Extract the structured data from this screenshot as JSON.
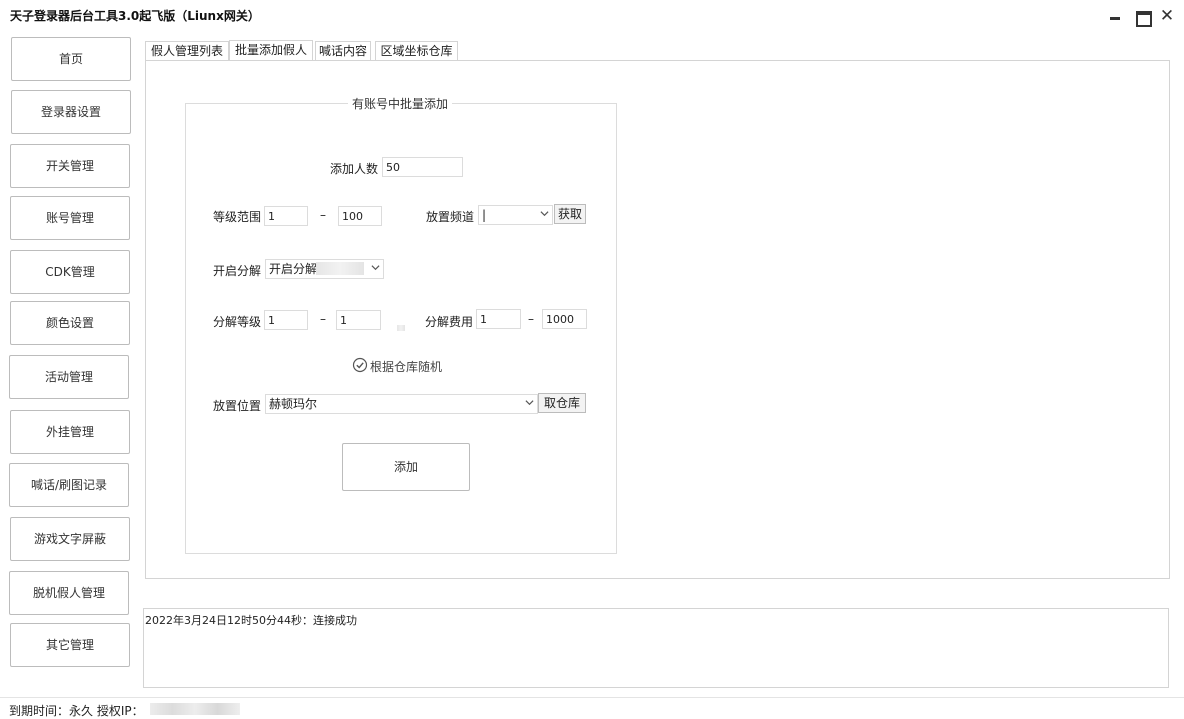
{
  "window": {
    "title": "天子登录器后台工具3.0起飞版（Liunx网关）",
    "close_glyph": "✕"
  },
  "sidebar": {
    "items": [
      {
        "label": "首页"
      },
      {
        "label": "登录器设置"
      },
      {
        "label": "开关管理"
      },
      {
        "label": "账号管理"
      },
      {
        "label": "CDK管理"
      },
      {
        "label": "颜色设置"
      },
      {
        "label": "活动管理"
      },
      {
        "label": "外挂管理"
      },
      {
        "label": "喊话/刷图记录"
      },
      {
        "label": "游戏文字屏蔽"
      },
      {
        "label": "脱机假人管理"
      },
      {
        "label": "其它管理"
      }
    ]
  },
  "tabs": [
    {
      "label": "假人管理列表",
      "active": false
    },
    {
      "label": "批量添加假人",
      "active": true
    },
    {
      "label": "喊话内容",
      "active": false
    },
    {
      "label": "区域坐标仓库",
      "active": false
    }
  ],
  "form": {
    "group_title": "有账号中批量添加",
    "add_count": {
      "label": "添加人数",
      "value": "50"
    },
    "level_range": {
      "label": "等级范围",
      "min": "1",
      "dash": "–",
      "max": "100"
    },
    "channel": {
      "label": "放置频道",
      "value": "|",
      "fetch_label": "获取"
    },
    "decompose": {
      "label": "开启分解",
      "value": "开启分解"
    },
    "decompose_level": {
      "label": "分解等级",
      "min": "1",
      "dash": "–",
      "max": "1"
    },
    "decompose_cost": {
      "label": "分解费用",
      "min": "1",
      "dash": "–",
      "max": "1000"
    },
    "random_checkbox": {
      "label": "根据仓库随机",
      "checked": true
    },
    "location": {
      "label": "放置位置",
      "value": "赫顿玛尔",
      "warehouse_label": "取仓库"
    },
    "submit_label": "添加"
  },
  "log": {
    "lines": [
      "2022年3月24日12时50分44秒：连接成功"
    ]
  },
  "status": {
    "text": "到期时间：永久   授权IP："
  },
  "colors": {
    "border": "#d4d4d4",
    "button_border": "#bcbcbc",
    "text": "#222222"
  }
}
